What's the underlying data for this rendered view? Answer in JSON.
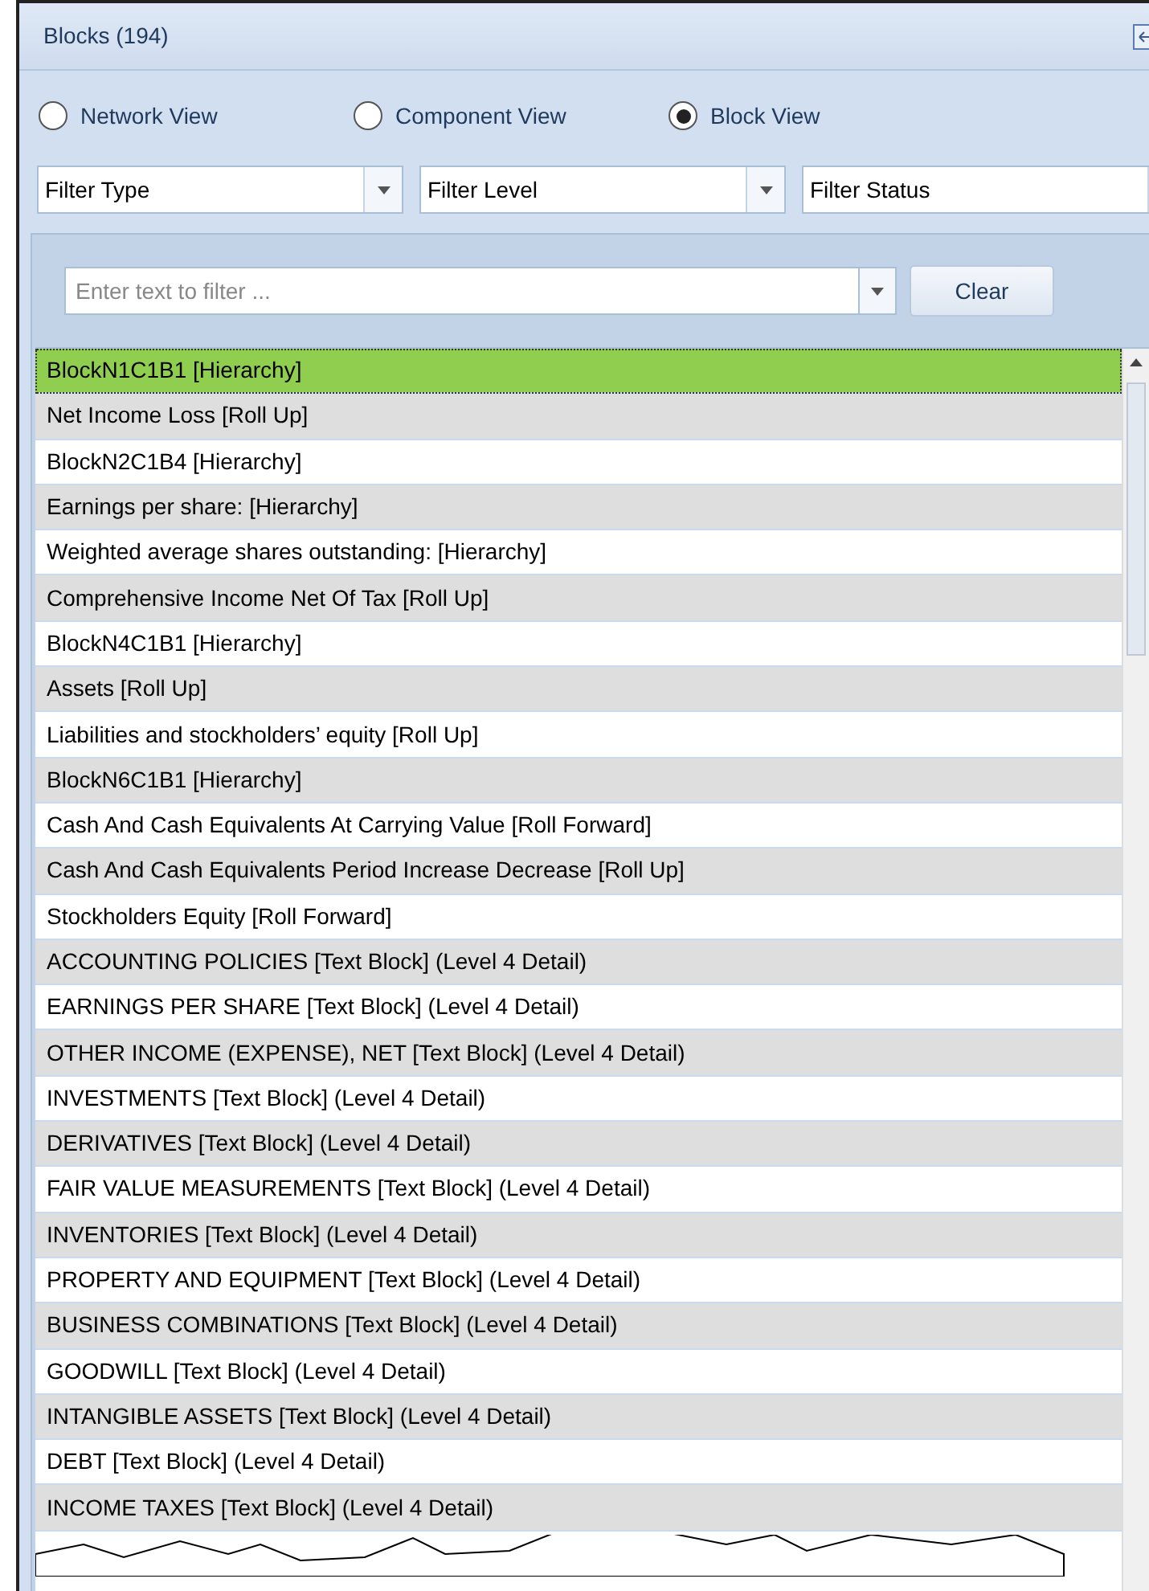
{
  "panel": {
    "title": "Blocks (194)"
  },
  "views": [
    {
      "label": "Network View",
      "selected": false
    },
    {
      "label": "Component View",
      "selected": false
    },
    {
      "label": "Block View",
      "selected": true
    }
  ],
  "filters": [
    {
      "label": "Filter Type"
    },
    {
      "label": "Filter Level"
    },
    {
      "label": "Filter Status"
    }
  ],
  "search": {
    "placeholder": "Enter text to filter ...",
    "button": "Clear"
  },
  "rows": [
    {
      "label": "BlockN1C1B1 [Hierarchy]",
      "selected": true
    },
    {
      "label": "Net Income Loss [Roll Up]",
      "selected": false
    },
    {
      "label": "BlockN2C1B4 [Hierarchy]",
      "selected": false
    },
    {
      "label": "Earnings per share: [Hierarchy]",
      "selected": false
    },
    {
      "label": "Weighted average shares outstanding: [Hierarchy]",
      "selected": false
    },
    {
      "label": "Comprehensive Income Net Of Tax [Roll Up]",
      "selected": false
    },
    {
      "label": "BlockN4C1B1 [Hierarchy]",
      "selected": false
    },
    {
      "label": "Assets [Roll Up]",
      "selected": false
    },
    {
      "label": "Liabilities and stockholders’ equity [Roll Up]",
      "selected": false
    },
    {
      "label": "BlockN6C1B1 [Hierarchy]",
      "selected": false
    },
    {
      "label": "Cash And Cash Equivalents At Carrying Value [Roll Forward]",
      "selected": false
    },
    {
      "label": "Cash And Cash Equivalents Period Increase Decrease [Roll Up]",
      "selected": false
    },
    {
      "label": "Stockholders Equity [Roll Forward]",
      "selected": false
    },
    {
      "label": "ACCOUNTING POLICIES [Text Block] (Level 4 Detail)",
      "selected": false
    },
    {
      "label": "EARNINGS PER SHARE [Text Block] (Level 4 Detail)",
      "selected": false
    },
    {
      "label": "OTHER INCOME (EXPENSE), NET [Text Block] (Level 4 Detail)",
      "selected": false
    },
    {
      "label": "INVESTMENTS [Text Block] (Level 4 Detail)",
      "selected": false
    },
    {
      "label": "DERIVATIVES [Text Block] (Level 4 Detail)",
      "selected": false
    },
    {
      "label": "FAIR VALUE MEASUREMENTS [Text Block] (Level 4 Detail)",
      "selected": false
    },
    {
      "label": "INVENTORIES [Text Block] (Level 4 Detail)",
      "selected": false
    },
    {
      "label": "PROPERTY AND EQUIPMENT [Text Block] (Level 4 Detail)",
      "selected": false
    },
    {
      "label": "BUSINESS COMBINATIONS [Text Block] (Level 4 Detail)",
      "selected": false
    },
    {
      "label": "GOODWILL [Text Block] (Level 4 Detail)",
      "selected": false
    },
    {
      "label": "INTANGIBLE ASSETS [Text Block] (Level 4 Detail)",
      "selected": false
    },
    {
      "label": "DEBT [Text Block] (Level 4 Detail)",
      "selected": false
    },
    {
      "label": "INCOME TAXES [Text Block] (Level 4 Detail)",
      "selected": false
    }
  ]
}
